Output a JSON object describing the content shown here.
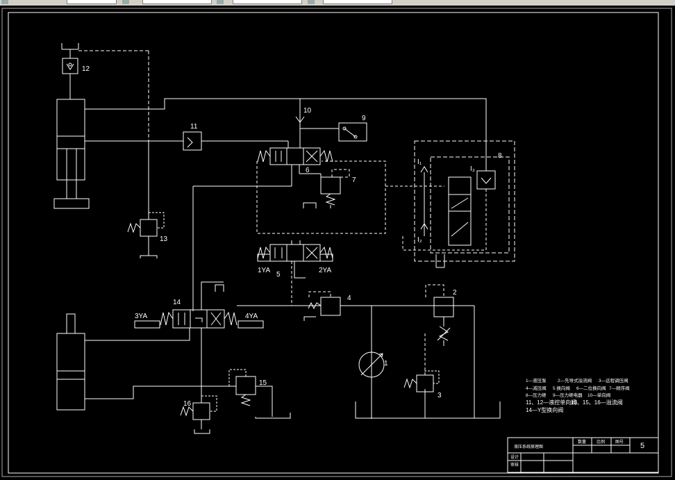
{
  "colors": {
    "background": "#000000",
    "line": "#ffffff",
    "toolbar": "#d4d0c8"
  },
  "toolbar": {
    "icons": [
      "arrow-icon",
      "folder-icon",
      "layer-icon",
      "image-icon"
    ]
  },
  "labels": {
    "n1": "1",
    "n2": "2",
    "n3": "3",
    "n4": "4",
    "n5": "5",
    "n6": "6",
    "n7": "7",
    "n8": "8",
    "n9": "9",
    "n10": "10",
    "n11": "11",
    "n12": "12",
    "n13": "13",
    "n14": "14",
    "n15": "15",
    "n16": "16",
    "ya1": "1YA",
    "ya2": "2YA",
    "ya3": "3YA",
    "ya4": "4YA",
    "i1": "I₁",
    "i2": "I₂",
    "i3": "I₃"
  },
  "legend": {
    "row1": [
      "1—液压泵",
      "2—先导式溢流阀",
      "3—远程调压阀"
    ],
    "row2": [
      "4—减压阀",
      "5 换向阀",
      "6—二位换向阀",
      "7—顺序阀"
    ],
    "row3": [
      "8—压力继",
      "9—压力继电器",
      "10—单向阀"
    ],
    "row4": [
      "11、12—液控单向阀",
      "13、15、16—溢流阀"
    ],
    "row5": [
      "14—Y型换向阀"
    ]
  },
  "title_block": {
    "title": "液压系统原理图",
    "col1": "数量",
    "col2": "比例",
    "col3": "图号",
    "sheet": "5",
    "row_design": "设计",
    "row_check": "审核"
  }
}
